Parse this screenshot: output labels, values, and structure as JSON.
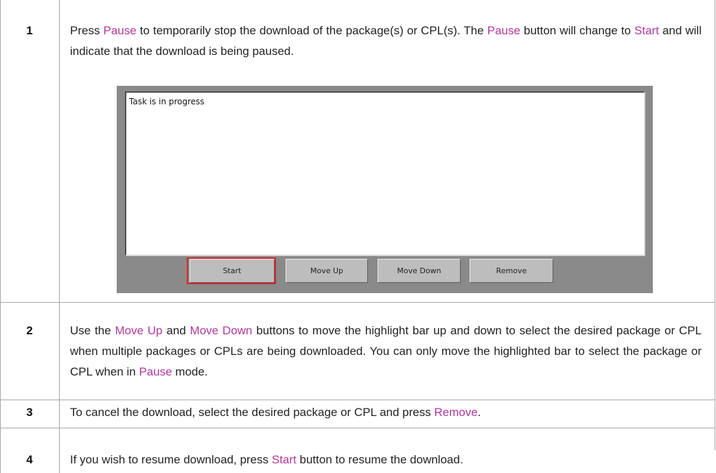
{
  "steps": [
    {
      "number": "1",
      "segments": [
        {
          "t": "Press ",
          "k": false
        },
        {
          "t": "Pause",
          "k": true
        },
        {
          "t": " to temporarily stop the download of the package(s) or CPL(s). The ",
          "k": false
        },
        {
          "t": "Pause",
          "k": true
        },
        {
          "t": " button will change to ",
          "k": false
        },
        {
          "t": "Start",
          "k": true
        },
        {
          "t": " and will indicate that the download is being paused.",
          "k": false
        }
      ]
    },
    {
      "number": "2",
      "segments": [
        {
          "t": "Use the ",
          "k": false
        },
        {
          "t": "Move Up",
          "k": true
        },
        {
          "t": " and ",
          "k": false
        },
        {
          "t": "Move Down",
          "k": true
        },
        {
          "t": " buttons to move the highlight bar up and down to select the desired package or CPL when multiple packages or CPLs are being downloaded. You can only move the highlighted bar to select the package or CPL when in ",
          "k": false
        },
        {
          "t": "Pause",
          "k": true
        },
        {
          "t": " mode.",
          "k": false
        }
      ]
    },
    {
      "number": "3",
      "segments": [
        {
          "t": "To cancel the download, select the desired package or CPL and press ",
          "k": false
        },
        {
          "t": "Remove",
          "k": true
        },
        {
          "t": ".",
          "k": false
        }
      ]
    },
    {
      "number": "4",
      "segments": [
        {
          "t": "If you wish to resume download, press ",
          "k": false
        },
        {
          "t": "Start",
          "k": true
        },
        {
          "t": " button to resume the download.",
          "k": false
        }
      ]
    }
  ],
  "screenshot": {
    "status_text": "Task is in progress",
    "buttons": {
      "start": "Start",
      "move_up": "Move Up",
      "move_down": "Move Down",
      "remove": "Remove"
    }
  },
  "colors": {
    "keyword": "#b0389c",
    "highlight_border": "#d5262b",
    "table_rule": "#a6a6a6",
    "panel_bg": "#8a8a8a"
  }
}
